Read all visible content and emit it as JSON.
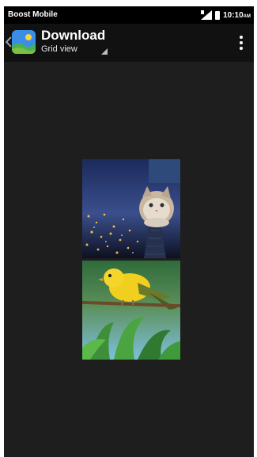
{
  "status_bar": {
    "carrier": "Boost Mobile",
    "time": "10:10",
    "time_suffix": "AM",
    "signal_icon": "signal-icon",
    "battery_icon": "battery-icon"
  },
  "app_bar": {
    "back_icon": "chevron-left-icon",
    "app_icon": "gallery-app-icon",
    "title": "Download",
    "subtitle": "Grid view",
    "menu_icon": "overflow-menu-icon"
  },
  "gallery": {
    "items": [
      {
        "description_icon": "photo-thumbnail"
      },
      {
        "description_icon": "photo-thumbnail"
      }
    ]
  },
  "colors": {
    "background": "#1e1e1e",
    "status_bar": "#000000",
    "app_bar": "#111111",
    "text": "#ffffff"
  }
}
